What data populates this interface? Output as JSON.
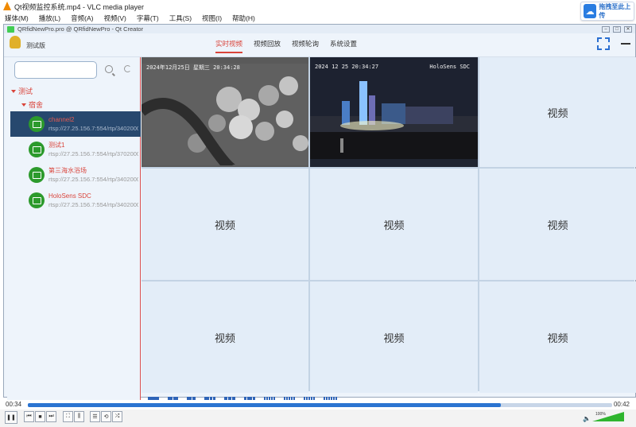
{
  "vlc": {
    "title": "Qt视频监控系统.mp4 - VLC media player",
    "window_controls": [
      "–",
      "□",
      "✕"
    ],
    "menu": [
      "媒体(M)",
      "播放(L)",
      "音频(A)",
      "视频(V)",
      "字幕(T)",
      "工具(S)",
      "视图(I)",
      "帮助(H)"
    ],
    "time_current": "00:34",
    "time_total": "00:42",
    "progress": 0.81,
    "volume": "100%",
    "controls": [
      "pause",
      "previous",
      "stop",
      "next",
      "fullscreen",
      "extended-settings",
      "playlist",
      "loop",
      "shuffle"
    ]
  },
  "upload_badge": {
    "label": "拖拽至此上传"
  },
  "qt": {
    "title": "QRfidNewPro.pro @ QRfidNewPro - Qt Creator",
    "window_controls": [
      "–",
      "□",
      "✕"
    ]
  },
  "app": {
    "name": "测试版",
    "tabs": [
      {
        "label": "实时视频",
        "active": true
      },
      {
        "label": "视频回放",
        "active": false
      },
      {
        "label": "视频轮询",
        "active": false
      },
      {
        "label": "系统设置",
        "active": false
      }
    ]
  },
  "sidebar": {
    "search_placeholder": "",
    "tree_root": "测试",
    "tree_sub": "宿舍",
    "channels": [
      {
        "name": "channel2",
        "url": "rtsp://27.25.156.7:554/rtp/34020000",
        "selected": true
      },
      {
        "name": "测试1",
        "url": "rtsp://27.25.156.7:554/rtp/37020000",
        "selected": false
      },
      {
        "name": "第三海水浴场",
        "url": "rtsp://27.25.156.7:554/rtp/34020000",
        "selected": false
      },
      {
        "name": "HoloSens SDC",
        "url": "rtsp://27.25.156.7:554/rtp/34020000",
        "selected": false
      }
    ]
  },
  "grid": {
    "feed1_osd": "2024年12月25日 星期三 20:34:28",
    "feed2_osd": "2024 12 25 20:34:27",
    "feed2_brand": "HoloSens SDC",
    "placeholder_label": "视频",
    "placeholder_cells": 7
  },
  "layouts": [
    "1",
    "4",
    "6",
    "8",
    "9",
    "13",
    "16",
    "25",
    "36",
    "64"
  ]
}
